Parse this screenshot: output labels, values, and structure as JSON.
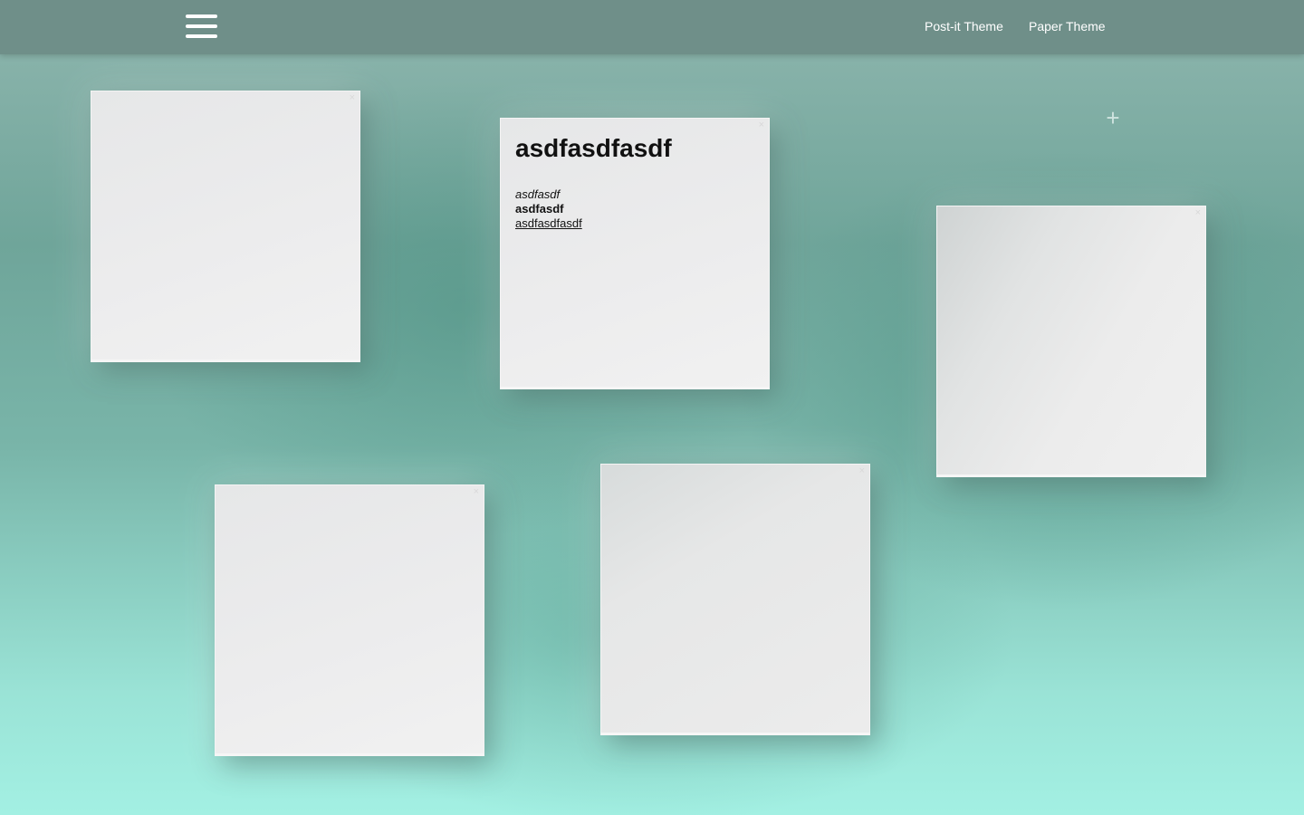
{
  "topbar": {
    "menu_icon": "hamburger-menu-icon",
    "links": [
      {
        "label": "Post-it Theme"
      },
      {
        "label": "Paper Theme"
      }
    ]
  },
  "add_note": {
    "icon": "plus-icon",
    "glyph": "+"
  },
  "notes": [
    {
      "title": "",
      "close_glyph": "×"
    },
    {
      "title": "asdfasdfasdf",
      "close_glyph": "×",
      "italic_text": "asdfasdf",
      "bold_text": "asdfasdf",
      "link_text": "asdfasdfasdf"
    },
    {
      "title": "",
      "close_glyph": "×"
    },
    {
      "title": "",
      "close_glyph": "×"
    },
    {
      "title": "",
      "close_glyph": "×"
    }
  ],
  "colors": {
    "topbar": "#6f8f89",
    "note": "#ececed",
    "background_top": "#8fb6ae",
    "background_bottom": "#a3f0e3"
  }
}
